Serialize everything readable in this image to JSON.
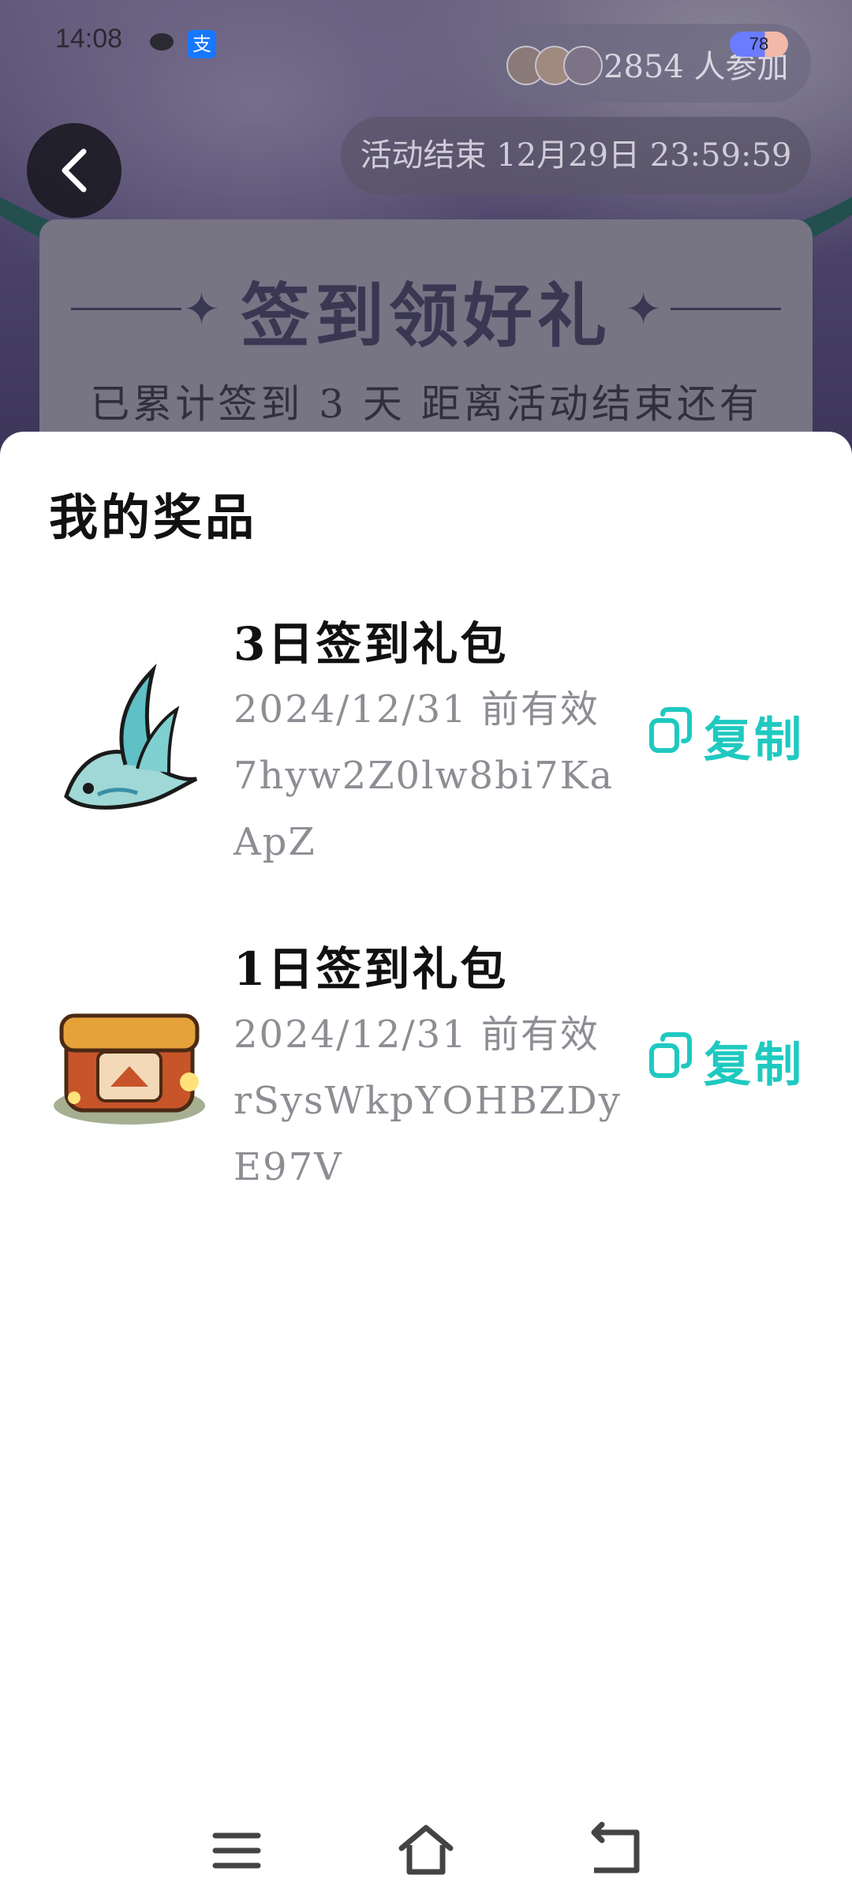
{
  "status_bar": {
    "time": "14:08",
    "alipay_glyph": "支",
    "battery": "78"
  },
  "header": {
    "participants": "2854 人参加",
    "event_end": "活动结束 12月29日 23:59:59",
    "checkin_title": "签到领好礼",
    "checkin_subtitle": "已累计签到 3 天 距离活动结束还有"
  },
  "sheet": {
    "title": "我的奖品",
    "accent_color": "#1fc9c0",
    "prizes": [
      {
        "name": "3日签到礼包",
        "expire": "2024/12/31 前有效",
        "code": "7hyw2Z0lw8bi7KaApZ",
        "copy_label": "复制",
        "icon": "spirit-fish-icon"
      },
      {
        "name": "1日签到礼包",
        "expire": "2024/12/31 前有效",
        "code": "rSysWkpYOHBZDyE97V",
        "copy_label": "复制",
        "icon": "treasure-chest-icon"
      }
    ]
  },
  "nav_bar": {
    "icons": [
      "menu-icon",
      "home-icon",
      "back-icon"
    ]
  }
}
